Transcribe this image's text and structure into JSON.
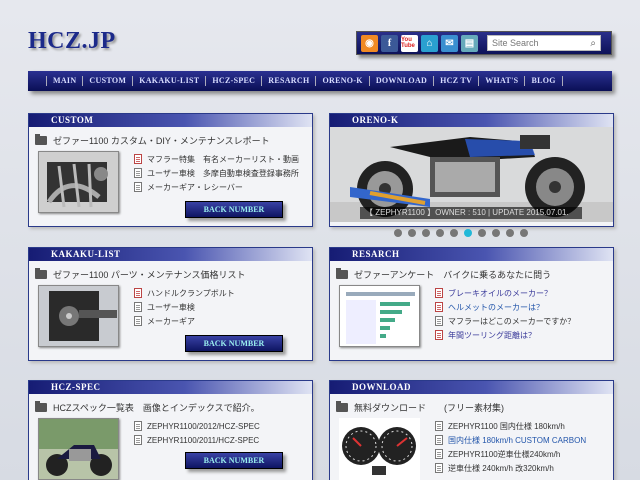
{
  "site": {
    "logo": "HCZ.JP"
  },
  "search": {
    "placeholder": "Site Search"
  },
  "toolbar": {
    "icons": [
      "rss-icon",
      "facebook-icon",
      "youtube-icon",
      "home-icon",
      "chat-icon",
      "mail-icon"
    ],
    "fb": "f",
    "yt": "You Tube"
  },
  "nav": [
    "MAIN",
    "CUSTOM",
    "KAKAKU-LIST",
    "HCZ-SPEC",
    "RESARCH",
    "ORENO-K",
    "DOWNLOAD",
    "HCZ TV",
    "WHAT'S",
    "BLOG"
  ],
  "custom": {
    "title": "CUSTOM",
    "subtitle": "ゼファー1100 カスタム・DIY・メンテナンスレポート",
    "items": [
      "マフラー特集　有名メーカーリスト・動画",
      "ユーザー車検　多摩自動車検査登録事務所",
      "メーカーギア・レシーバー"
    ],
    "button": "BACK NUMBER"
  },
  "oreno": {
    "title": "ORENO-K",
    "caption": "【 ZEPHYR1100 】OWNER : 510 | UPDATE 2015.07.01.",
    "slides": 10,
    "active": 5
  },
  "kakaku": {
    "title": "KAKAKU-LIST",
    "subtitle": "ゼファー1100 パーツ・メンテナンス価格リスト",
    "items": [
      "ハンドルクランプボルト",
      "ユーザー車検",
      "メーカーギア"
    ],
    "button": "BACK NUMBER"
  },
  "resarch": {
    "title": "RESARCH",
    "subtitle": "ゼファーアンケート　バイクに乗るあなたに問う",
    "items": [
      "ブレーキオイルのメーカー？",
      "ヘルメットのメーカーは？",
      "マフラーはどこのメーカーですか？",
      "年間ツーリング距離は？"
    ]
  },
  "spec": {
    "title": "HCZ-SPEC",
    "subtitle": "HCZスペック一覧表　画像とインデックスで紹介。",
    "items": [
      "ZEPHYR1100/2012/HCZ-SPEC",
      "ZEPHYR1100/2011/HCZ-SPEC"
    ],
    "button": "BACK NUMBER"
  },
  "download": {
    "title": "DOWNLOAD",
    "subtitle": "無料ダウンロード　　(フリー素材集)",
    "items": [
      "ZEPHYR1100 国内仕様 180km/h",
      "国内仕様 180km/h CUSTOM CARBON",
      "ZEPHYR1100逆車仕様240km/h",
      "逆車仕様 240km/h 改320km/h"
    ]
  },
  "colors": {
    "nav": "#0a0f55",
    "accent": "#22b8d8"
  }
}
